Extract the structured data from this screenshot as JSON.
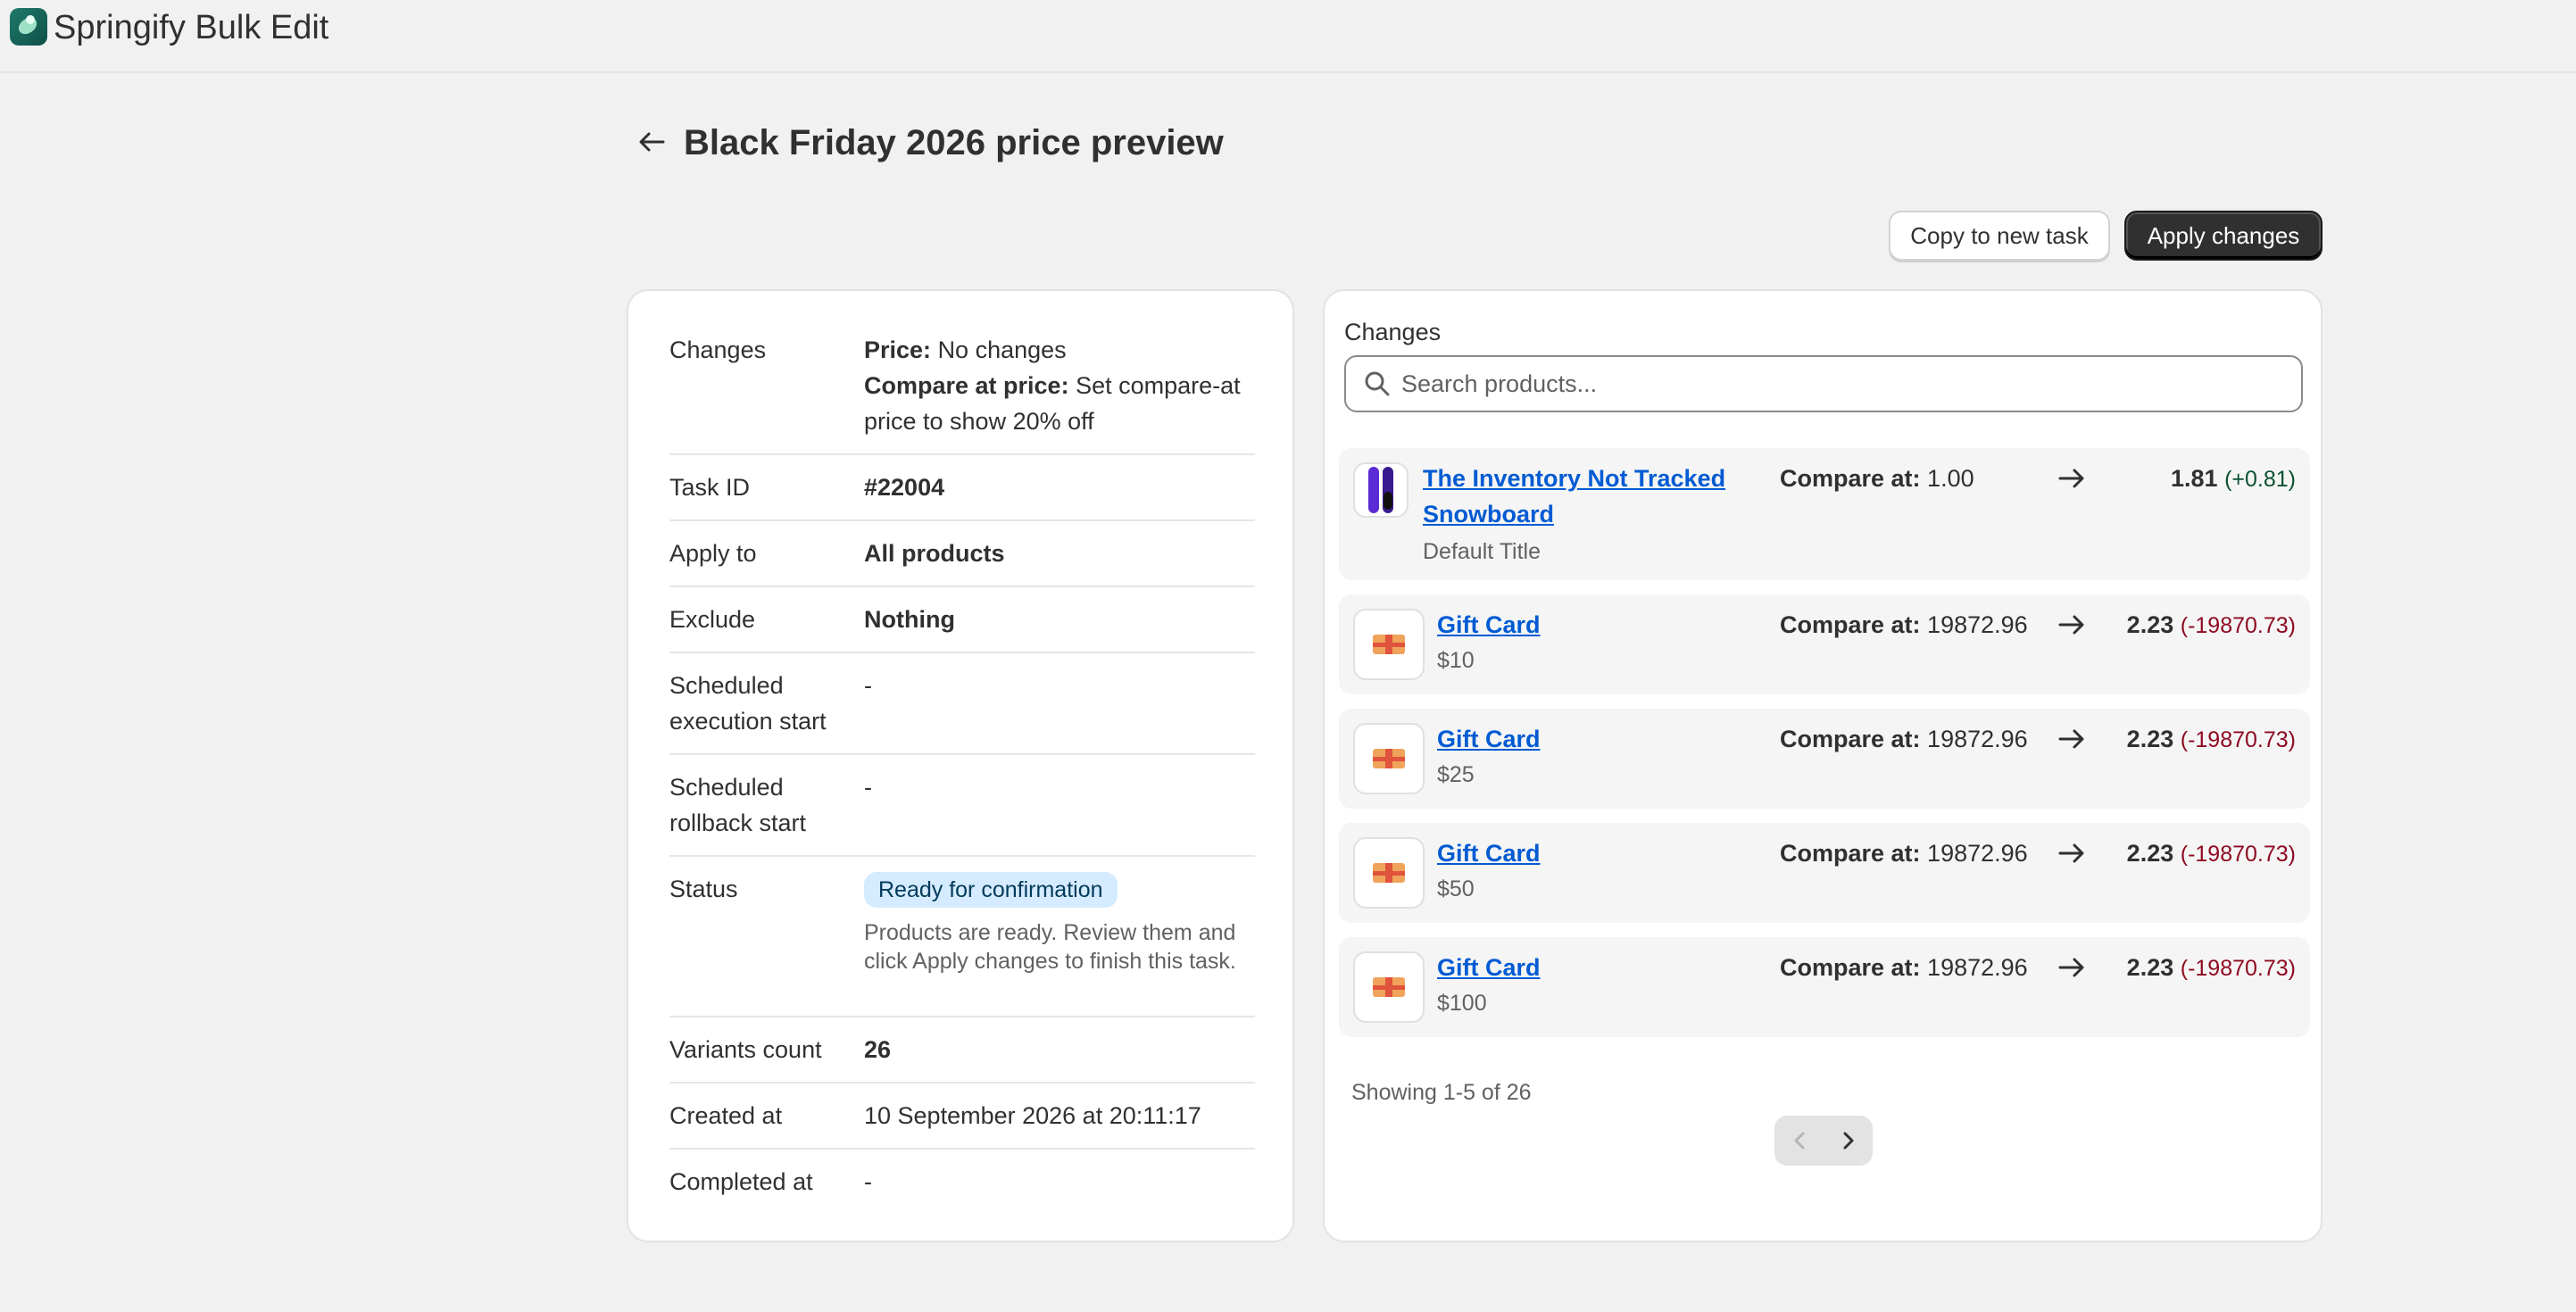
{
  "app": {
    "title": "Springify Bulk Edit"
  },
  "page": {
    "title": "Black Friday 2026 price preview"
  },
  "actions": {
    "copy_label": "Copy to new task",
    "apply_label": "Apply changes"
  },
  "details": {
    "changes_label": "Changes",
    "price_key": "Price:",
    "price_value": "No changes",
    "compare_key": "Compare at price:",
    "compare_value": "Set compare-at price to show 20% off",
    "task_id_label": "Task ID",
    "task_id": "#22004",
    "apply_to_label": "Apply to",
    "apply_to": "All products",
    "exclude_label": "Exclude",
    "exclude": "Nothing",
    "sched_exec_label": "Scheduled execution start",
    "sched_exec": "-",
    "sched_rollback_label": "Scheduled rollback start",
    "sched_rollback": "-",
    "status_label": "Status",
    "status_badge": "Ready for confirmation",
    "status_note": "Products are ready. Review them and click Apply changes to finish this task.",
    "variants_label": "Variants count",
    "variants": "26",
    "created_label": "Created at",
    "created": "10 September 2026 at 20:11:17",
    "completed_label": "Completed at",
    "completed": "-"
  },
  "changes": {
    "title": "Changes",
    "search_placeholder": "Search products...",
    "compare_prefix": "Compare at:",
    "items": [
      {
        "title": "The Inventory Not Tracked Snowboard",
        "variant": "Default Title",
        "compare_at": "1.00",
        "new_value": "1.81",
        "delta": "(+0.81)",
        "thumb": "snowboard-icon"
      },
      {
        "title": "Gift Card",
        "variant": "$10",
        "compare_at": "19872.96",
        "new_value": "2.23",
        "delta": "(-19870.73)",
        "thumb": "gift-card-icon"
      },
      {
        "title": "Gift Card",
        "variant": "$25",
        "compare_at": "19872.96",
        "new_value": "2.23",
        "delta": "(-19870.73)",
        "thumb": "gift-card-icon"
      },
      {
        "title": "Gift Card",
        "variant": "$50",
        "compare_at": "19872.96",
        "new_value": "2.23",
        "delta": "(-19870.73)",
        "thumb": "gift-card-icon"
      },
      {
        "title": "Gift Card",
        "variant": "$100",
        "compare_at": "19872.96",
        "new_value": "2.23",
        "delta": "(-19870.73)",
        "thumb": "gift-card-icon"
      }
    ],
    "showing": "Showing 1-5 of 26"
  },
  "colors": {
    "primary": "#303030",
    "link": "#005bd3",
    "badge_bg": "#d5ebff",
    "positive": "#0c5132",
    "negative": "#8e0b21"
  }
}
